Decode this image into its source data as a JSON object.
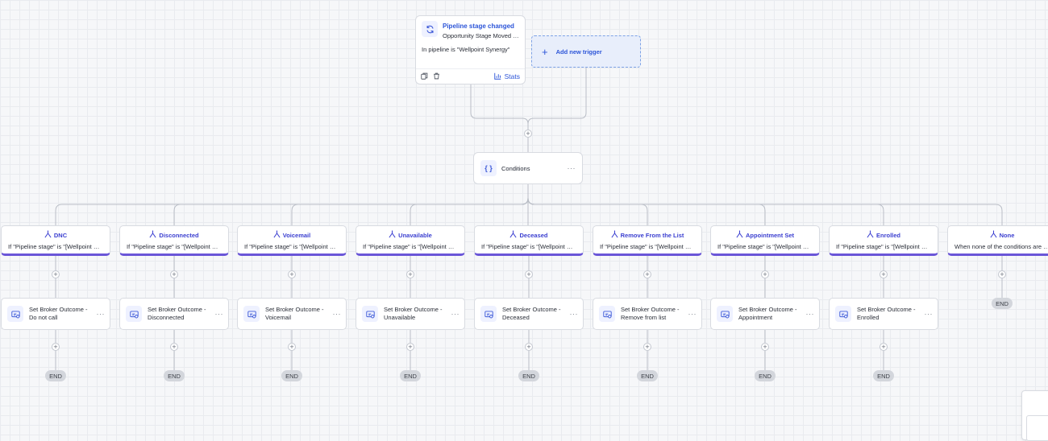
{
  "trigger": {
    "title": "Pipeline stage changed",
    "subtitle": "Opportunity Stage Moved - ...",
    "filter": "In pipeline is \"Wellpoint Synergy\"",
    "stats_label": "Stats"
  },
  "add_trigger": {
    "label": "Add new trigger"
  },
  "conditions": {
    "label": "Conditions"
  },
  "branches": [
    {
      "title": "DNC",
      "condition": "If \"Pipeline stage\" is \"[Wellpoint Synergy] DNC\"",
      "action": "Set Broker Outcome - Do not call"
    },
    {
      "title": "Disconnected",
      "condition": "If \"Pipeline stage\" is \"[Wellpoint Synergy] Disconnected\"",
      "action": "Set Broker Outcome - Disconnected"
    },
    {
      "title": "Voicemail",
      "condition": "If \"Pipeline stage\" is \"[Wellpoint Synergy] Voicemail\"",
      "action": "Set Broker Outcome - Voicemail"
    },
    {
      "title": "Unavailable",
      "condition": "If \"Pipeline stage\" is \"[Wellpoint Synergy] Unavailable\"",
      "action": "Set Broker Outcome - Unavailable"
    },
    {
      "title": "Deceased",
      "condition": "If \"Pipeline stage\" is \"[Wellpoint Synergy] Deceased\"",
      "action": "Set Broker Outcome - Deceased"
    },
    {
      "title": "Remove From the List",
      "condition": "If \"Pipeline stage\" is \"[Wellpoint Synergy] Remove From the List\"",
      "action": "Set Broker Outcome - Remove from list"
    },
    {
      "title": "Appointment Set",
      "condition": "If \"Pipeline stage\" is \"[Wellpoint Synergy] Appointment Set\"",
      "action": "Set Broker Outcome - Appointment"
    },
    {
      "title": "Enrolled",
      "condition": "If \"Pipeline stage\" is \"[Wellpoint Synergy] Enrolled\"",
      "action": "Set Broker Outcome - Enrolled"
    },
    {
      "title": "None",
      "condition": "When none of the conditions are met",
      "action": null
    }
  ],
  "end_label": "END",
  "colors": {
    "accent": "#2b54d8",
    "branch_accent": "#6a56d8",
    "end_pill": "#d3d6dc"
  }
}
